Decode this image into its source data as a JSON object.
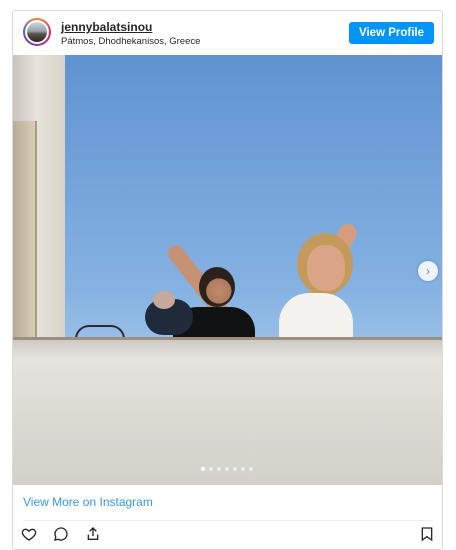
{
  "header": {
    "username": "jennybalatsinou",
    "location": "Pátmos, Dhodhekanisos, Greece",
    "view_profile_label": "View Profile"
  },
  "carousel": {
    "slide_count": 7,
    "active_index": 0
  },
  "footer": {
    "link_label": "View More on Instagram"
  },
  "colors": {
    "accent": "#0095f6",
    "link": "#3897f0"
  },
  "icons": [
    "heart-icon",
    "comment-icon",
    "share-icon",
    "bookmark-icon",
    "chevron-right-icon"
  ]
}
